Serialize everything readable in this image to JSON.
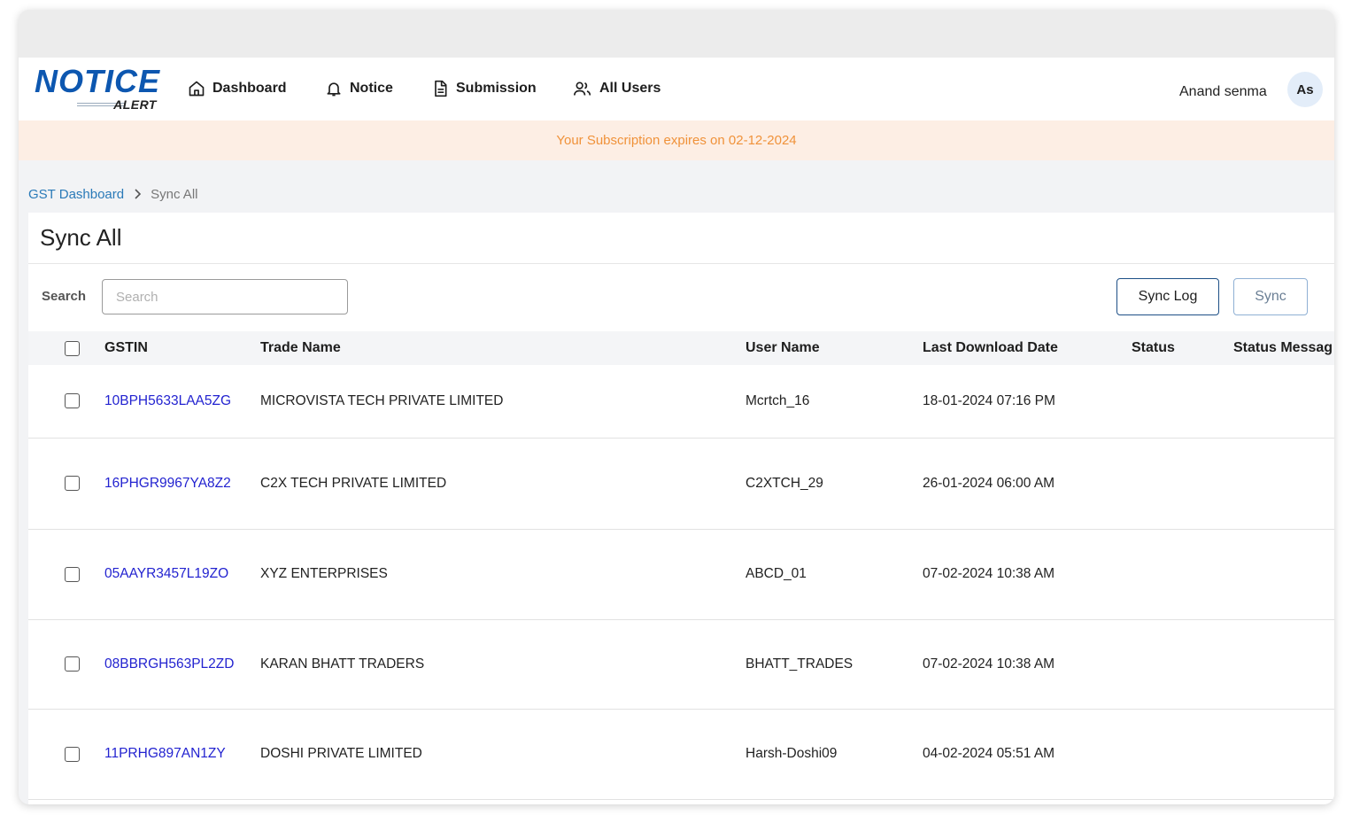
{
  "app": {
    "logo_main": "NOTICE",
    "logo_sub": "ALERT"
  },
  "nav": {
    "items": [
      {
        "label": "Dashboard",
        "icon": "home-icon"
      },
      {
        "label": "Notice",
        "icon": "bell-icon"
      },
      {
        "label": "Submission",
        "icon": "document-icon"
      },
      {
        "label": "All Users",
        "icon": "users-icon"
      }
    ]
  },
  "user": {
    "name": "Anand senma",
    "initials": "As"
  },
  "banner": {
    "text": "Your Subscription expires on 02-12-2024"
  },
  "breadcrumb": {
    "parent": "GST Dashboard",
    "current": "Sync All"
  },
  "page": {
    "title": "Sync All"
  },
  "search": {
    "label": "Search",
    "placeholder": "Search",
    "value": ""
  },
  "buttons": {
    "sync_log": "Sync Log",
    "sync": "Sync"
  },
  "table": {
    "columns": [
      "GSTIN",
      "Trade Name",
      "User Name",
      "Last Download Date",
      "Status",
      "Status Messag"
    ],
    "rows": [
      {
        "gstin": "10BPH5633LAA5ZG",
        "trade_name": "MICROVISTA TECH PRIVATE LIMITED",
        "user_name": "Mcrtch_16",
        "last_download": "18-01-2024 07:16 PM",
        "status": "",
        "message": ""
      },
      {
        "gstin": "16PHGR9967YA8Z2",
        "trade_name": "C2X TECH PRIVATE LIMITED",
        "user_name": "C2XTCH_29",
        "last_download": "26-01-2024 06:00 AM",
        "status": "",
        "message": ""
      },
      {
        "gstin": "05AAYR3457L19ZO",
        "trade_name": "XYZ ENTERPRISES",
        "user_name": "ABCD_01",
        "last_download": "07-02-2024 10:38 AM",
        "status": "",
        "message": ""
      },
      {
        "gstin": "08BBRGH563PL2ZD",
        "trade_name": "KARAN BHATT TRADERS",
        "user_name": "BHATT_TRADES",
        "last_download": "07-02-2024 10:38 AM",
        "status": "",
        "message": ""
      },
      {
        "gstin": "11PRHG897AN1ZY",
        "trade_name": "DOSHI PRIVATE LIMITED",
        "user_name": "Harsh-Doshi09",
        "last_download": "04-02-2024 05:51 AM",
        "status": "",
        "message": ""
      }
    ]
  },
  "colors": {
    "brand_blue": "#0d57b0",
    "link_blue": "#2323d0",
    "banner_bg": "#fdeee4",
    "banner_text": "#f0923a"
  }
}
